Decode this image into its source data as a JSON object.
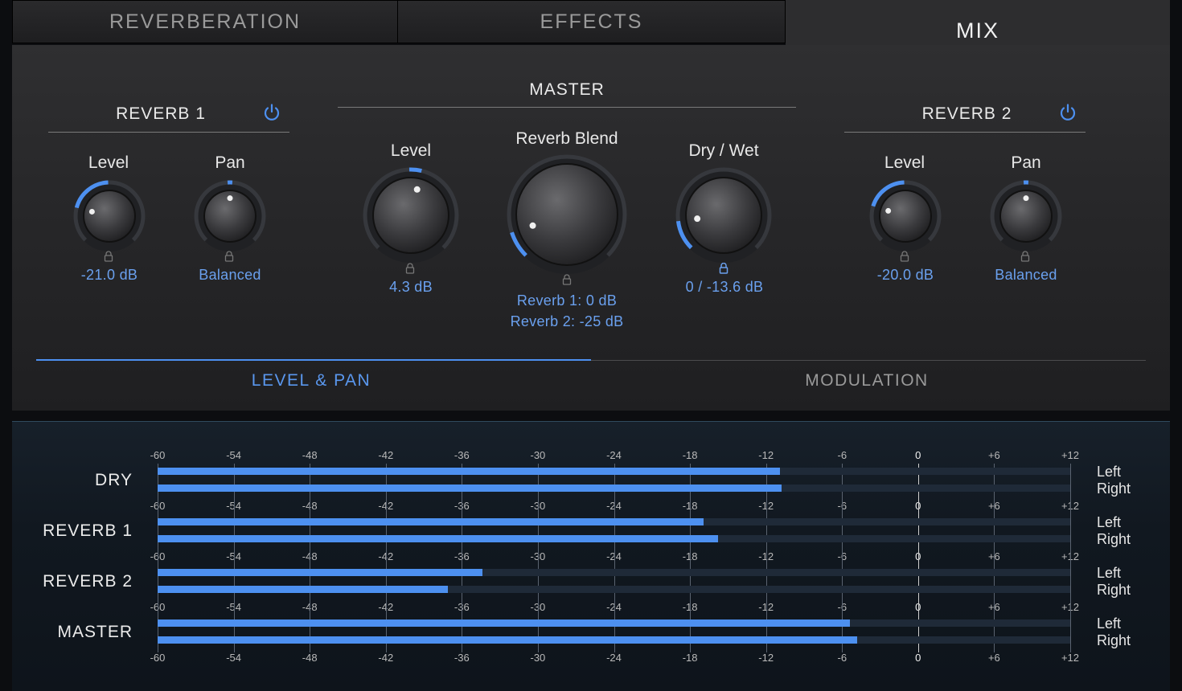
{
  "tabs": [
    {
      "label": "REVERBERATION",
      "active": false
    },
    {
      "label": "EFFECTS",
      "active": false
    },
    {
      "label": "MIX",
      "active": true
    }
  ],
  "reverb1": {
    "title": "REVERB 1",
    "level": {
      "label": "Level",
      "value": "-21.0 dB",
      "fraction": 0.22
    },
    "pan": {
      "label": "Pan",
      "value": "Balanced",
      "fraction": 0.5
    }
  },
  "master": {
    "title": "MASTER",
    "level": {
      "label": "Level",
      "value": "4.3 dB",
      "fraction": 0.55
    },
    "blend": {
      "label": "Reverb Blend",
      "value_line1": "Reverb 1: 0 dB",
      "value_line2": "Reverb 2: -25 dB",
      "fraction": 0.1
    },
    "drywet": {
      "label": "Dry / Wet",
      "value": "0 / -13.6 dB",
      "fraction": 0.14
    }
  },
  "reverb2": {
    "title": "REVERB 2",
    "level": {
      "label": "Level",
      "value": "-20.0 dB",
      "fraction": 0.23
    },
    "pan": {
      "label": "Pan",
      "value": "Balanced",
      "fraction": 0.5
    }
  },
  "subtabs": [
    {
      "label": "LEVEL & PAN",
      "active": true
    },
    {
      "label": "MODULATION",
      "active": false
    }
  ],
  "meters": {
    "scale": [
      "-60",
      "-54",
      "-48",
      "-42",
      "-36",
      "-30",
      "-24",
      "-18",
      "-12",
      "-6",
      "0",
      "+6",
      "+12"
    ],
    "channel_left": "Left",
    "channel_right": "Right",
    "rows": [
      {
        "name": "DRY",
        "left_db": -10.9,
        "right_db": -10.8
      },
      {
        "name": "REVERB 1",
        "left_db": -16.9,
        "right_db": -15.8
      },
      {
        "name": "REVERB 2",
        "left_db": -34.4,
        "right_db": -37.1
      },
      {
        "name": "MASTER",
        "left_db": -5.4,
        "right_db": -4.8
      }
    ]
  },
  "colors": {
    "accent": "#4d90f0",
    "value_text": "#6aa0ee"
  }
}
